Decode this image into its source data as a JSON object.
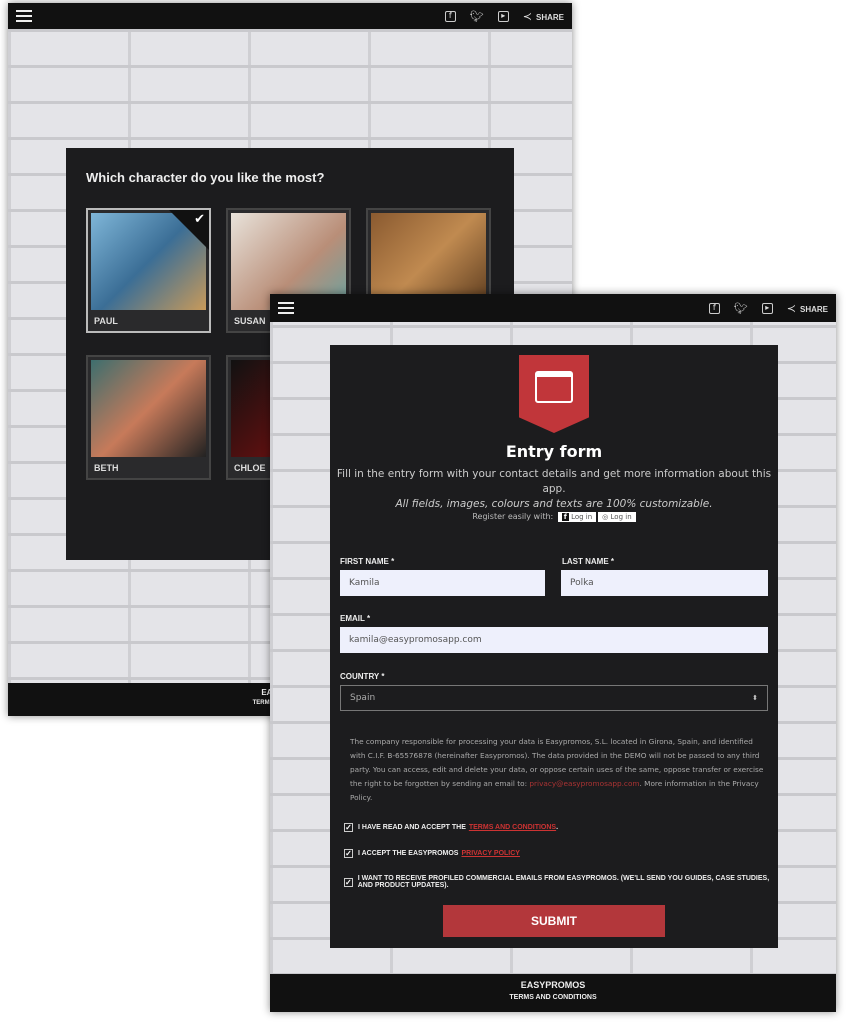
{
  "header": {
    "share_label": "SHARE",
    "icons": [
      "menu-icon",
      "facebook-icon",
      "twitter-icon",
      "youtube-icon",
      "share-icon"
    ]
  },
  "quiz": {
    "question": "Which character do you like the most?",
    "characters": [
      {
        "name": "PAUL",
        "selected": true
      },
      {
        "name": "SUSAN",
        "selected": false
      },
      {
        "name": "",
        "selected": false
      },
      {
        "name": "BETH",
        "selected": false
      },
      {
        "name": "CHLOE",
        "selected": false
      }
    ]
  },
  "footer": {
    "brand": "EASYPROMOS",
    "terms": "TERMS AND CONDITIONS"
  },
  "form": {
    "title": "Entry form",
    "subtitle": "Fill in the entry form with your contact details and get more information about this app.",
    "subtitle_italic": "All fields, images, colours and texts are 100% customizable.",
    "register_label": "Register easily with:",
    "facebook_login": "Log in",
    "instagram_login": "Log in",
    "first_name_label": "FIRST NAME *",
    "first_name_value": "Kamila",
    "last_name_label": "LAST NAME *",
    "last_name_value": "Polka",
    "email_label": "EMAIL *",
    "email_value": "kamila@easypromosapp.com",
    "country_label": "COUNTRY *",
    "country_value": "Spain",
    "legal_text": "The company responsible for processing your data is Easypromos, S.L. located in Girona, Spain, and identified with C.I.F. B-65576878 (hereinafter Easypromos). The data provided in the DEMO will not be passed to any third party. You can access, edit and delete your data, or oppose certain uses of the same, oppose transfer or exercise the right to be forgotten by sending an email to:",
    "legal_email": "privacy@easypromosapp.com",
    "legal_tail": ". More information in the Privacy Policy.",
    "checkboxes": [
      {
        "text": "I HAVE READ AND ACCEPT THE",
        "link": "TERMS AND CONDITIONS",
        "checked": true
      },
      {
        "text": "I ACCEPT THE EASYPROMOS",
        "link": "PRIVACY POLICY",
        "checked": true
      },
      {
        "text": "I WANT TO RECEIVE PROFILED COMMERCIAL EMAILS FROM EASYPROMOS. (WE'LL SEND YOU GUIDES, CASE STUDIES, AND PRODUCT UPDATES).",
        "link": "",
        "checked": true
      }
    ],
    "submit_label": "SUBMIT"
  },
  "colors": {
    "accent": "#b3373b",
    "panel": "#1c1c1e",
    "bar": "#111111"
  }
}
